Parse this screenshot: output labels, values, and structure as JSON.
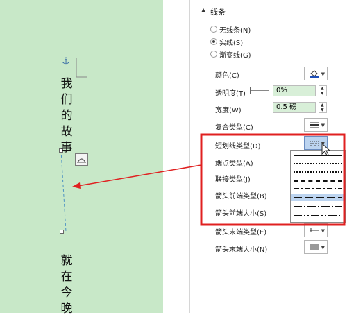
{
  "document": {
    "text_top": [
      "我",
      "们",
      "的",
      "故",
      "事"
    ],
    "text_bottom": [
      "就",
      "在",
      "今",
      "晚"
    ]
  },
  "panel": {
    "section_title": "线条",
    "radios": [
      {
        "label": "无线条(N)",
        "selected": false
      },
      {
        "label": "实线(S)",
        "selected": true
      },
      {
        "label": "渐变线(G)",
        "selected": false
      }
    ],
    "color_label": "颜色(C)",
    "transparency_label": "透明度(T)",
    "transparency_value": "0%",
    "width_label": "宽度(W)",
    "width_value": "0.5 磅",
    "compound_label": "复合类型(C)",
    "dash_label": "短划线类型(D)",
    "cap_label": "端点类型(A)",
    "join_label": "联接类型(J)",
    "arrow_begin_type_label": "箭头前端类型(B)",
    "arrow_begin_size_label": "箭头前端大小(S)",
    "arrow_end_type_label": "箭头末端类型(E)",
    "arrow_end_size_label": "箭头末端大小(N)"
  },
  "dash_options": [
    "solid",
    "round-dot",
    "square-dot",
    "dash",
    "dash-dot",
    "long-dash",
    "long-dash-dot",
    "long-dash-dot-dot"
  ],
  "dash_selected_index": 5,
  "colors": {
    "doc_bg": "#c8e8c8",
    "highlight": "#e02020",
    "field_bg": "#d8efd8",
    "selected_option": "#bcd4f0"
  }
}
